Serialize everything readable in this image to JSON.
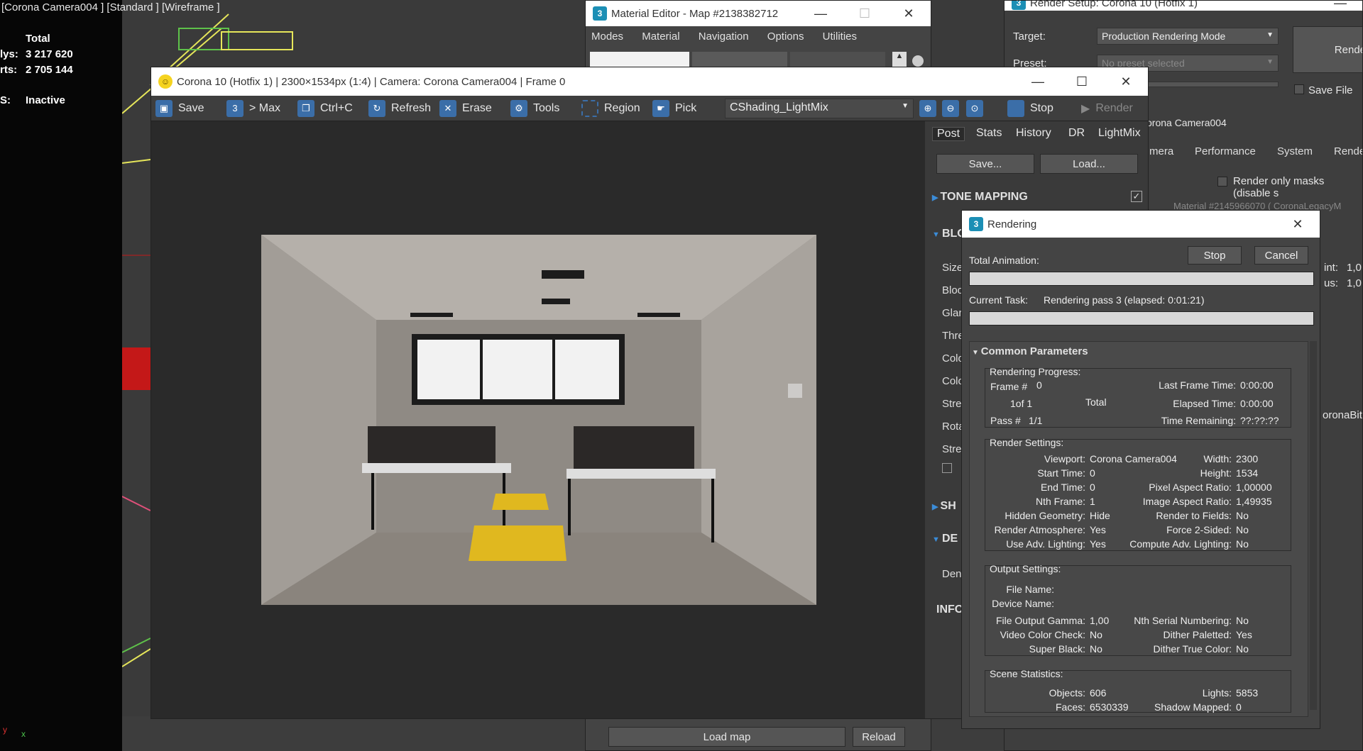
{
  "viewport": {
    "title": "[Corona Camera004 ] [Standard ] [Wireframe ]",
    "stats": {
      "header": "Total",
      "polys_label": "lys:",
      "polys_value": "3 217 620",
      "verts_label": "rts:",
      "verts_value": "2 705 144",
      "fps_label": "S:",
      "fps_value": "Inactive"
    },
    "axis_x": "x",
    "axis_y": "y"
  },
  "material_editor": {
    "title": "Material Editor - Map #2138382712",
    "menu": [
      "Modes",
      "Material",
      "Navigation",
      "Options",
      "Utilities"
    ],
    "load_map": "Load map",
    "reload": "Reload"
  },
  "render_setup": {
    "title": "Render Setup: Corona 10 (Hotfix 1)",
    "target_label": "Target:",
    "target_value": "Production Rendering Mode",
    "preset_label": "Preset:",
    "preset_value": "No preset selected",
    "render_button": "Rende",
    "save_file": "Save File",
    "camera": "orona Camera004",
    "tabs": [
      "mera",
      "Performance",
      "System",
      "Rende"
    ],
    "render_masks": "Render only masks (disable s",
    "material_line": "Material #2145966070  ( CoronaLegacyM",
    "side_vals": [
      "int:",
      "1,0",
      "us:",
      "1,0"
    ],
    "bitmap": "oronaBitm"
  },
  "vfb": {
    "title": "Corona 10 (Hotfix 1) | 2300×1534px (1:4) | Camera: Corona Camera004 | Frame 0",
    "toolbar": {
      "save": "Save",
      "to_max": "> Max",
      "copy": "Ctrl+C",
      "refresh": "Refresh",
      "erase": "Erase",
      "tools": "Tools",
      "region": "Region",
      "pick": "Pick",
      "channel": "CShading_LightMix",
      "stop": "Stop",
      "render": "Render"
    },
    "side_tabs": [
      "Post",
      "Stats",
      "History",
      "DR",
      "LightMix"
    ],
    "save_btn": "Save...",
    "load_btn": "Load...",
    "tone_mapping": "TONE MAPPING",
    "bloom": "BLO",
    "rows": [
      "Size",
      "Bloo",
      "Glar",
      "Thre",
      "Colo",
      "Colo",
      "Stre",
      "Rota",
      "Stre"
    ],
    "sharpen": "SH",
    "denoise": "DE",
    "den_row": "Den",
    "info": "INFO"
  },
  "rendering": {
    "title": "Rendering",
    "total_animation": "Total Animation:",
    "stop": "Stop",
    "cancel": "Cancel",
    "current_task_label": "Current Task:",
    "current_task": "Rendering pass 3 (elapsed: 0:01:21)",
    "common_parameters": "Common Parameters",
    "progress": {
      "title": "Rendering Progress:",
      "frame_label": "Frame #",
      "frame": "0",
      "of": "1of 1",
      "total": "Total",
      "pass_label": "Pass #",
      "pass": "1/1",
      "last_frame_label": "Last Frame Time:",
      "last_frame": "0:00:00",
      "elapsed_label": "Elapsed Time:",
      "elapsed": "0:00:00",
      "remaining_label": "Time Remaining:",
      "remaining": "??:??:??"
    },
    "settings": {
      "title": "Render Settings:",
      "left": [
        [
          "Viewport:",
          "Corona Camera004"
        ],
        [
          "Start Time:",
          "0"
        ],
        [
          "End Time:",
          "0"
        ],
        [
          "Nth Frame:",
          "1"
        ],
        [
          "Hidden Geometry:",
          "Hide"
        ],
        [
          "Render Atmosphere:",
          "Yes"
        ],
        [
          "Use Adv. Lighting:",
          "Yes"
        ]
      ],
      "right": [
        [
          "Width:",
          "2300"
        ],
        [
          "Height:",
          "1534"
        ],
        [
          "Pixel Aspect Ratio:",
          "1,00000"
        ],
        [
          "Image Aspect Ratio:",
          "1,49935"
        ],
        [
          "Render to Fields:",
          "No"
        ],
        [
          "Force 2-Sided:",
          "No"
        ],
        [
          "Compute Adv. Lighting:",
          "No"
        ]
      ]
    },
    "output": {
      "title": "Output Settings:",
      "file_name": "File Name:",
      "device_name": "Device Name:",
      "left": [
        [
          "File Output Gamma:",
          "1,00"
        ],
        [
          "Video Color Check:",
          "No"
        ],
        [
          "Super Black:",
          "No"
        ]
      ],
      "right": [
        [
          "Nth Serial Numbering:",
          "No"
        ],
        [
          "Dither Paletted:",
          "Yes"
        ],
        [
          "Dither True Color:",
          "No"
        ]
      ]
    },
    "scene": {
      "title": "Scene Statistics:",
      "objects_label": "Objects:",
      "objects": "606",
      "faces_label": "Faces:",
      "faces": "6530339",
      "lights_label": "Lights:",
      "lights": "5853",
      "shadow_label": "Shadow Mapped:",
      "shadow": "0"
    }
  },
  "colors": {
    "accent": "#3b6ea8",
    "floor_mark": "#e0b81f"
  }
}
